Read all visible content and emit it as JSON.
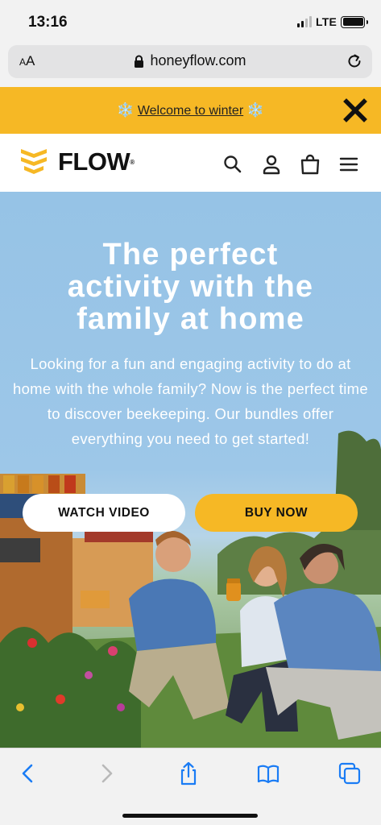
{
  "status_bar": {
    "time": "13:16",
    "network": "LTE"
  },
  "browser": {
    "text_size_label": "AA",
    "url": "honeyflow.com"
  },
  "announcement": {
    "snowflake": "❄️",
    "text": "Welcome to winter"
  },
  "header": {
    "brand": "FLOW",
    "registered": "®"
  },
  "hero": {
    "title_lines": [
      "The perfect",
      "activity with the",
      "family at home"
    ],
    "body": "Looking for a fun and engaging activity to do at home with the whole family? Now is the perfect time to discover beekeeping. Our bundles offer everything you need to get started!",
    "watch_video_label": "WATCH VIDEO",
    "buy_now_label": "BUY NOW"
  },
  "colors": {
    "accent": "#f6b825",
    "sky": "#9dc7e8",
    "snowflake": "#7fb6e6"
  }
}
